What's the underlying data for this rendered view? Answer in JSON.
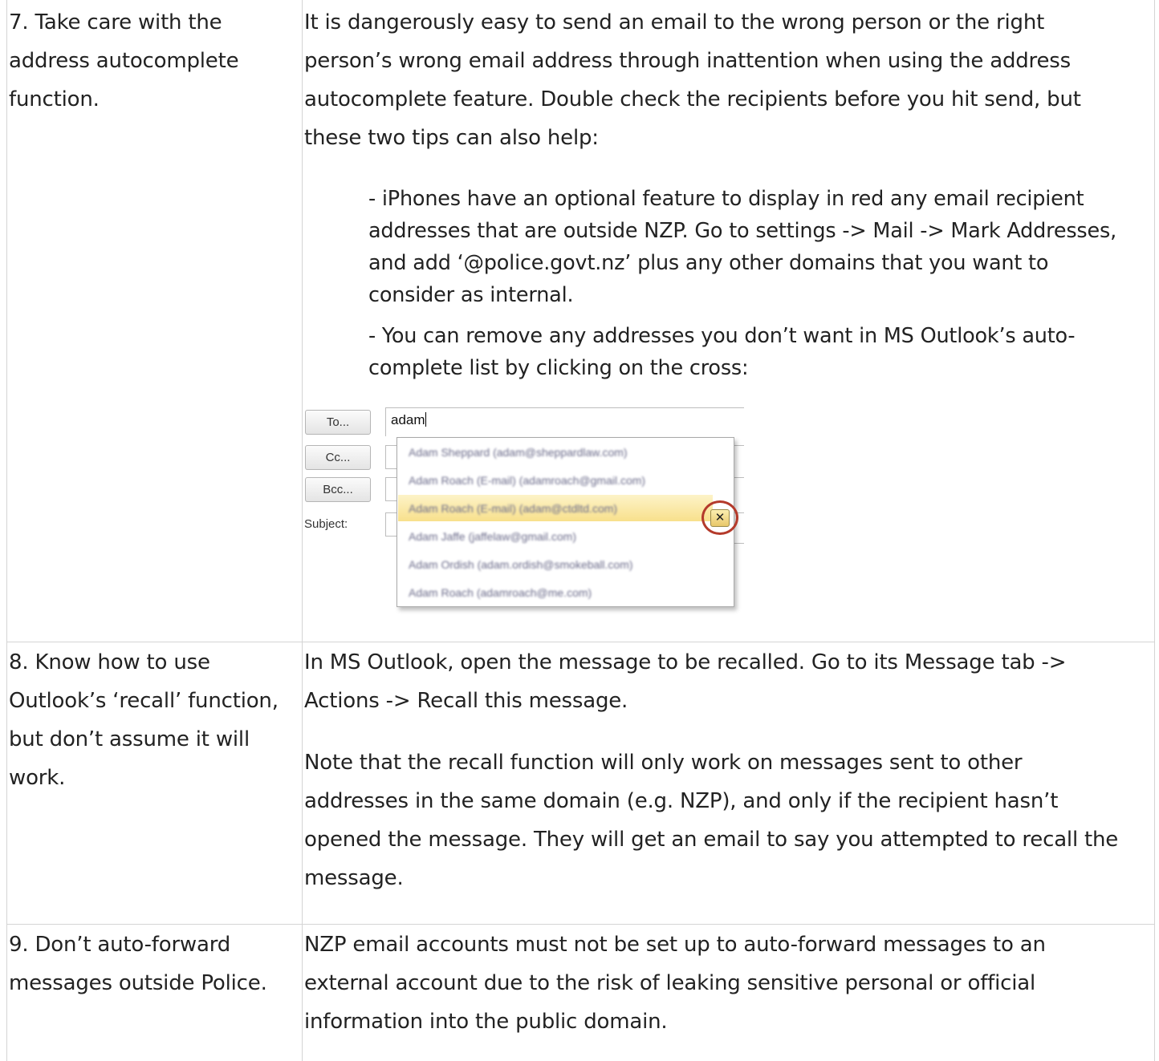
{
  "rows": [
    {
      "tip": "7. Take care with the\naddress autocomplete\nfunction.",
      "body": "It is dangerously easy to send an email to the wrong person or the right\nperson’s wrong email address through inattention when using the address\nautocomplete feature. Double check the recipients before you hit send, but\nthese two tips can also help:",
      "bullets": [
        "- iPhones have an optional feature to display in red any email recipient\naddresses that are outside NZP. Go to settings -> Mail -> Mark Addresses,\nand add ‘@police.govt.nz’ plus any other domains that you want to\nconsider as internal.",
        "- You can remove any addresses you don’t want in MS Outlook’s auto-\ncomplete list by clicking on the cross:"
      ]
    },
    {
      "tip": "8. Know how to use\nOutlook’s ‘recall’ function,\nbut don’t assume it will\nwork.",
      "body": "In MS Outlook, open the message to be recalled. Go to its Message tab ->\nActions -> Recall this message.",
      "body2": "Note that the recall function will only work on messages sent to other\naddresses in the same domain (e.g. NZP), and only if the recipient hasn’t\nopened the message. They will get an email to say you attempted to recall the\nmessage."
    },
    {
      "tip": "9. Don’t auto-forward\nmessages outside Police.",
      "body": "NZP email accounts must not be set up to auto-forward messages to an\nexternal account due to the risk of leaking sensitive personal or official\ninformation into the public domain."
    }
  ],
  "outlook": {
    "to_label": "To...",
    "cc_label": "Cc...",
    "bcc_label": "Bcc...",
    "subject_label": "Subject:",
    "to_value": "adam",
    "suggestions": [
      "Adam Sheppard (adam@sheppardlaw.com)",
      "Adam Roach (E-mail) (adamroach@gmail.com)",
      "Adam Roach (E-mail) (adam@ctdltd.com)",
      "Adam Jaffe (jaffelaw@gmail.com)",
      "Adam Ordish (adam.ordish@smokeball.com)",
      "Adam Roach (adamroach@me.com)"
    ],
    "remove_glyph": "✕"
  }
}
